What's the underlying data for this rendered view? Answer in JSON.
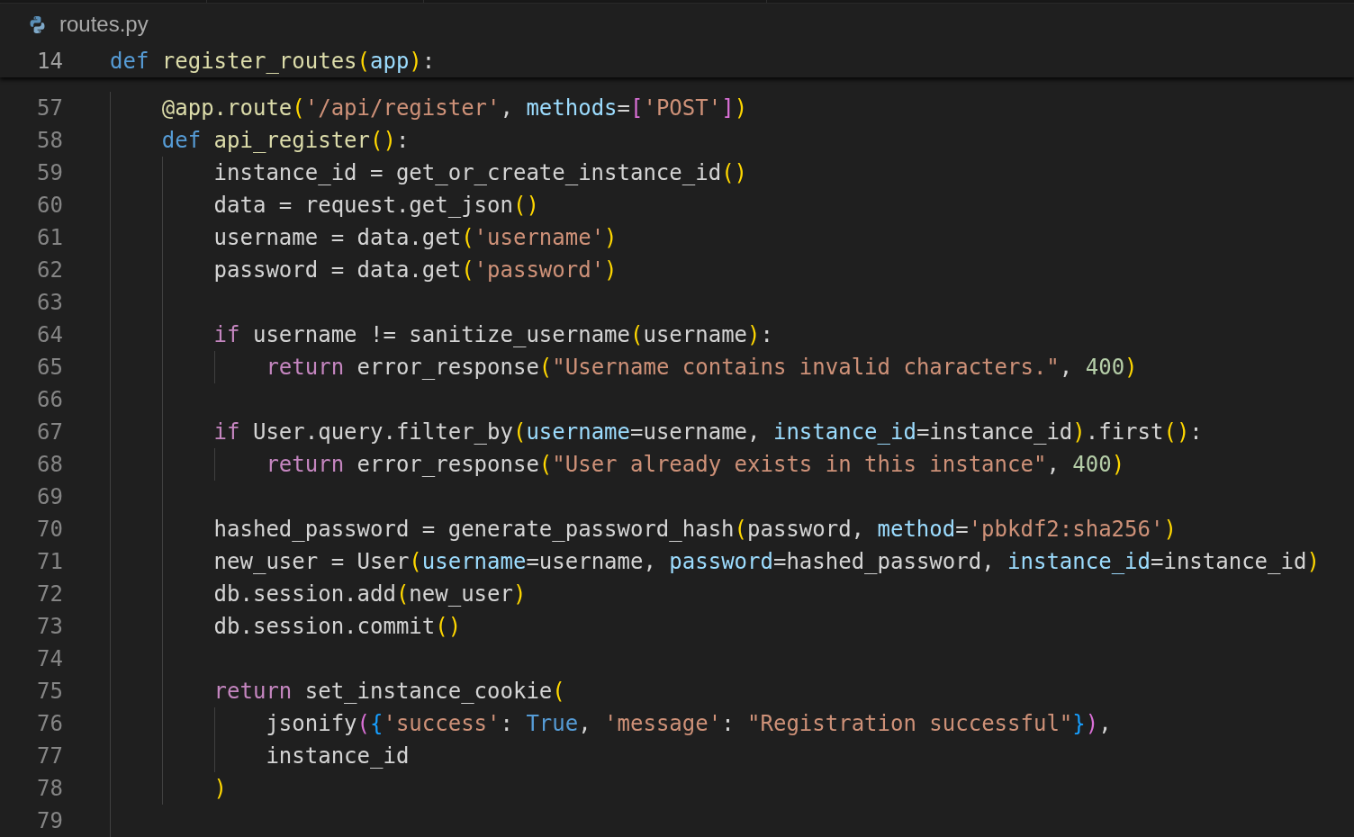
{
  "breadcrumb": {
    "file": "routes.py"
  },
  "sticky_line": {
    "number": "14",
    "tokens": [
      {
        "kind": "keyword",
        "text": "def"
      },
      {
        "kind": "function",
        "text": " register_routes"
      },
      {
        "kind": "bracket1",
        "text": "("
      },
      {
        "kind": "param",
        "text": "app"
      },
      {
        "kind": "bracket1",
        "text": ")"
      },
      {
        "kind": "plain",
        "text": ":"
      }
    ]
  },
  "lines": [
    {
      "number": "57",
      "tokens": [
        {
          "kind": "function",
          "text": "@app.route"
        },
        {
          "kind": "bracket1",
          "text": "("
        },
        {
          "kind": "string",
          "text": "'/api/register'"
        },
        {
          "kind": "plain",
          "text": ", "
        },
        {
          "kind": "param",
          "text": "methods"
        },
        {
          "kind": "plain",
          "text": "="
        },
        {
          "kind": "bracket2",
          "text": "["
        },
        {
          "kind": "string",
          "text": "'POST'"
        },
        {
          "kind": "bracket2",
          "text": "]"
        },
        {
          "kind": "bracket1",
          "text": ")"
        }
      ]
    },
    {
      "number": "58",
      "tokens": [
        {
          "kind": "keyword",
          "text": "def"
        },
        {
          "kind": "function",
          "text": " api_register"
        },
        {
          "kind": "bracket1",
          "text": "()"
        },
        {
          "kind": "plain",
          "text": ":"
        }
      ],
      "children": [
        {
          "number": "59",
          "tokens": [
            {
              "kind": "plain",
              "text": "instance_id = get_or_create_instance_id"
            },
            {
              "kind": "bracket1",
              "text": "()"
            }
          ]
        },
        {
          "number": "60",
          "tokens": [
            {
              "kind": "plain",
              "text": "data = request.get_json"
            },
            {
              "kind": "bracket1",
              "text": "()"
            }
          ]
        },
        {
          "number": "61",
          "tokens": [
            {
              "kind": "plain",
              "text": "username = data.get"
            },
            {
              "kind": "bracket1",
              "text": "("
            },
            {
              "kind": "string",
              "text": "'username'"
            },
            {
              "kind": "bracket1",
              "text": ")"
            }
          ]
        },
        {
          "number": "62",
          "tokens": [
            {
              "kind": "plain",
              "text": "password = data.get"
            },
            {
              "kind": "bracket1",
              "text": "("
            },
            {
              "kind": "string",
              "text": "'password'"
            },
            {
              "kind": "bracket1",
              "text": ")"
            }
          ]
        },
        {
          "number": "63"
        },
        {
          "number": "64",
          "tokens": [
            {
              "kind": "control",
              "text": "if"
            },
            {
              "kind": "plain",
              "text": " username != sanitize_username"
            },
            {
              "kind": "bracket1",
              "text": "("
            },
            {
              "kind": "plain",
              "text": "username"
            },
            {
              "kind": "bracket1",
              "text": ")"
            },
            {
              "kind": "plain",
              "text": ":"
            }
          ],
          "children": [
            {
              "number": "65",
              "tokens": [
                {
                  "kind": "control",
                  "text": "return"
                },
                {
                  "kind": "plain",
                  "text": " error_response"
                },
                {
                  "kind": "bracket1",
                  "text": "("
                },
                {
                  "kind": "string",
                  "text": "\"Username contains invalid characters.\""
                },
                {
                  "kind": "plain",
                  "text": ", "
                },
                {
                  "kind": "number",
                  "text": "400"
                },
                {
                  "kind": "bracket1",
                  "text": ")"
                }
              ]
            }
          ]
        },
        {
          "number": "66"
        },
        {
          "number": "67",
          "tokens": [
            {
              "kind": "control",
              "text": "if"
            },
            {
              "kind": "plain",
              "text": " User.query.filter_by"
            },
            {
              "kind": "bracket1",
              "text": "("
            },
            {
              "kind": "param",
              "text": "username"
            },
            {
              "kind": "plain",
              "text": "=username, "
            },
            {
              "kind": "param",
              "text": "instance_id"
            },
            {
              "kind": "plain",
              "text": "=instance_id"
            },
            {
              "kind": "bracket1",
              "text": ")"
            },
            {
              "kind": "plain",
              "text": ".first"
            },
            {
              "kind": "bracket1",
              "text": "()"
            },
            {
              "kind": "plain",
              "text": ":"
            }
          ],
          "children": [
            {
              "number": "68",
              "tokens": [
                {
                  "kind": "control",
                  "text": "return"
                },
                {
                  "kind": "plain",
                  "text": " error_response"
                },
                {
                  "kind": "bracket1",
                  "text": "("
                },
                {
                  "kind": "string",
                  "text": "\"User already exists in this instance\""
                },
                {
                  "kind": "plain",
                  "text": ", "
                },
                {
                  "kind": "number",
                  "text": "400"
                },
                {
                  "kind": "bracket1",
                  "text": ")"
                }
              ]
            }
          ]
        },
        {
          "number": "69"
        },
        {
          "number": "70",
          "tokens": [
            {
              "kind": "plain",
              "text": "hashed_password = generate_password_hash"
            },
            {
              "kind": "bracket1",
              "text": "("
            },
            {
              "kind": "plain",
              "text": "password, "
            },
            {
              "kind": "param",
              "text": "method"
            },
            {
              "kind": "plain",
              "text": "="
            },
            {
              "kind": "string",
              "text": "'pbkdf2:sha256'"
            },
            {
              "kind": "bracket1",
              "text": ")"
            }
          ]
        },
        {
          "number": "71",
          "tokens": [
            {
              "kind": "plain",
              "text": "new_user = User"
            },
            {
              "kind": "bracket1",
              "text": "("
            },
            {
              "kind": "param",
              "text": "username"
            },
            {
              "kind": "plain",
              "text": "=username, "
            },
            {
              "kind": "param",
              "text": "password"
            },
            {
              "kind": "plain",
              "text": "=hashed_password, "
            },
            {
              "kind": "param",
              "text": "instance_id"
            },
            {
              "kind": "plain",
              "text": "=instance_id"
            },
            {
              "kind": "bracket1",
              "text": ")"
            }
          ]
        },
        {
          "number": "72",
          "tokens": [
            {
              "kind": "plain",
              "text": "db.session.add"
            },
            {
              "kind": "bracket1",
              "text": "("
            },
            {
              "kind": "plain",
              "text": "new_user"
            },
            {
              "kind": "bracket1",
              "text": ")"
            }
          ]
        },
        {
          "number": "73",
          "tokens": [
            {
              "kind": "plain",
              "text": "db.session.commit"
            },
            {
              "kind": "bracket1",
              "text": "()"
            }
          ]
        },
        {
          "number": "74"
        },
        {
          "number": "75",
          "tokens": [
            {
              "kind": "control",
              "text": "return"
            },
            {
              "kind": "plain",
              "text": " set_instance_cookie"
            },
            {
              "kind": "bracket1",
              "text": "("
            }
          ],
          "children": [
            {
              "number": "76",
              "tokens": [
                {
                  "kind": "plain",
                  "text": "jsonify"
                },
                {
                  "kind": "bracket2",
                  "text": "("
                },
                {
                  "kind": "bracket3",
                  "text": "{"
                },
                {
                  "kind": "string",
                  "text": "'success'"
                },
                {
                  "kind": "plain",
                  "text": ": "
                },
                {
                  "kind": "keyword",
                  "text": "True"
                },
                {
                  "kind": "plain",
                  "text": ", "
                },
                {
                  "kind": "string",
                  "text": "'message'"
                },
                {
                  "kind": "plain",
                  "text": ": "
                },
                {
                  "kind": "string",
                  "text": "\"Registration successful\""
                },
                {
                  "kind": "bracket3",
                  "text": "}"
                },
                {
                  "kind": "bracket2",
                  "text": ")"
                },
                {
                  "kind": "plain",
                  "text": ","
                }
              ]
            },
            {
              "number": "77",
              "tokens": [
                {
                  "kind": "plain",
                  "text": "instance_id"
                }
              ]
            }
          ]
        },
        {
          "number": "78",
          "tokens": [
            {
              "kind": "bracket1",
              "text": ")"
            }
          ]
        }
      ]
    },
    {
      "number": "79"
    }
  ]
}
